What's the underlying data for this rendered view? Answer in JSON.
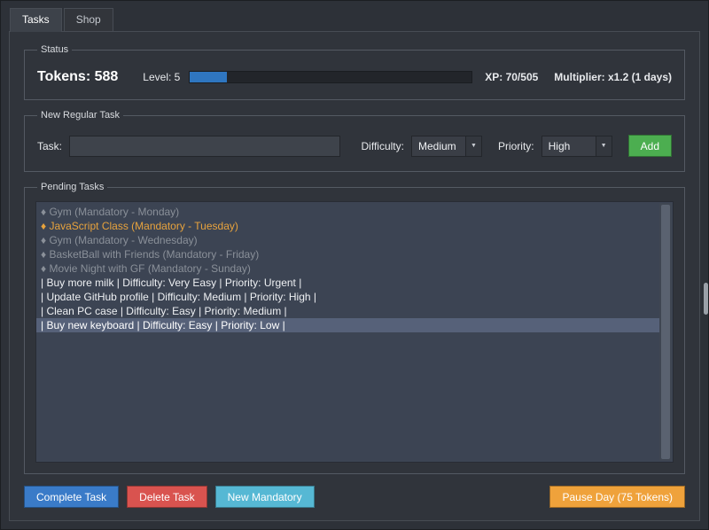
{
  "tabs": [
    {
      "label": "Tasks",
      "active": true
    },
    {
      "label": "Shop",
      "active": false
    }
  ],
  "status": {
    "title": "Status",
    "tokens": "Tokens: 588",
    "level": "Level: 5",
    "xp": "XP: 70/505",
    "multiplier": "Multiplier: x1.2 (1 days)",
    "progress_percent": 13
  },
  "new_task": {
    "title": "New Regular Task",
    "task_label": "Task:",
    "task_value": "",
    "difficulty_label": "Difficulty:",
    "difficulty_value": "Medium",
    "priority_label": "Priority:",
    "priority_value": "High",
    "add_label": "Add",
    "dropdown_arrow": "▼"
  },
  "pending": {
    "title": "Pending Tasks",
    "items": [
      {
        "text": "♦ Gym (Mandatory - Monday)",
        "type": "mandatory",
        "selected": false
      },
      {
        "text": "♦ JavaScript Class (Mandatory - Tuesday)",
        "type": "mandatory-active",
        "selected": false
      },
      {
        "text": "♦ Gym (Mandatory - Wednesday)",
        "type": "mandatory",
        "selected": false
      },
      {
        "text": "♦ BasketBall with Friends (Mandatory - Friday)",
        "type": "mandatory",
        "selected": false
      },
      {
        "text": "♦ Movie Night with GF (Mandatory - Sunday)",
        "type": "mandatory",
        "selected": false
      },
      {
        "text": "| Buy more milk | Difficulty: Very Easy | Priority: Urgent |",
        "type": "regular",
        "selected": false
      },
      {
        "text": "| Update GitHub profile | Difficulty: Medium | Priority: High |",
        "type": "regular",
        "selected": false
      },
      {
        "text": "| Clean PC case | Difficulty: Easy | Priority: Medium |",
        "type": "regular",
        "selected": false
      },
      {
        "text": "| Buy new keyboard | Difficulty: Easy | Priority: Low |",
        "type": "regular",
        "selected": true
      }
    ]
  },
  "footer": {
    "complete_label": "Complete Task",
    "delete_label": "Delete Task",
    "mandatory_label": "New Mandatory",
    "pause_label": "Pause Day (75 Tokens)"
  },
  "colors": {
    "accent_blue": "#3a7bc8",
    "green": "#4cae50",
    "red": "#d9534f",
    "cyan": "#56b8d4",
    "orange": "#efa23b",
    "progress_fill": "#2f76c0",
    "mandatory_gray": "#8a9099",
    "mandatory_active_orange": "#e8a33d",
    "selected_row": "#566179",
    "listbox_bg": "#3c4453"
  }
}
